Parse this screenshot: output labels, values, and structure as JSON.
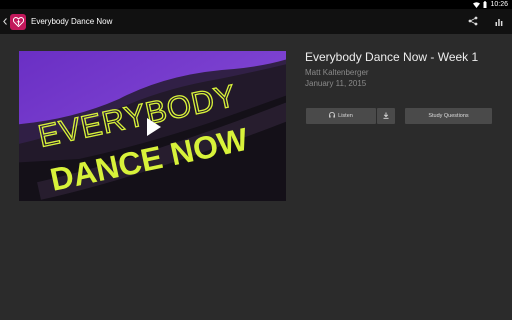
{
  "status_bar": {
    "time": "10:26"
  },
  "header": {
    "title": "Everybody Dance Now"
  },
  "media": {
    "thumbnail_line1": "EVERYBODY",
    "thumbnail_line2": "DANCE NOW"
  },
  "sermon": {
    "title": "Everybody Dance Now - Week 1",
    "speaker": "Matt Kaltenberger",
    "date": "January 11, 2015"
  },
  "buttons": {
    "listen_label": "Listen",
    "study_label": "Study Questions"
  },
  "colors": {
    "accent": "#c2185b",
    "thumbnail_purple": "#7d3fd0",
    "thumbnail_text": "#d8f23a"
  }
}
